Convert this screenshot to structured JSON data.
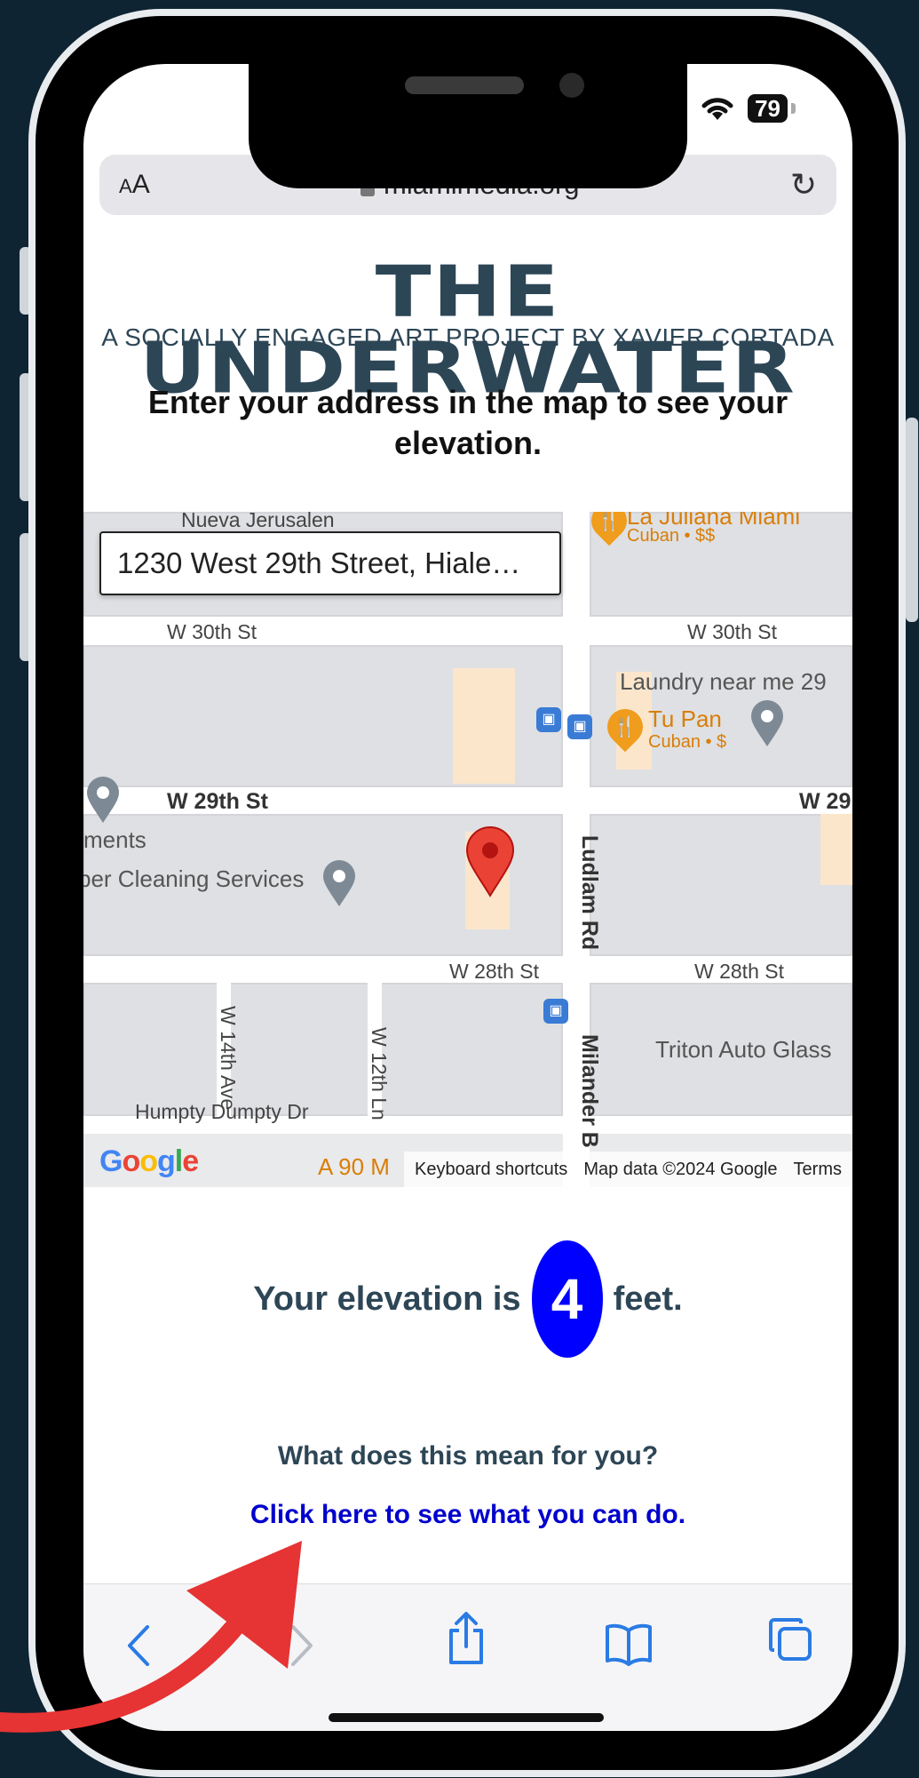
{
  "status": {
    "battery": "79"
  },
  "browser": {
    "text_size_label": "AA",
    "url": "miamimedia.org",
    "reload_icon": "reload-icon"
  },
  "page": {
    "title": "THE UNDERWATER",
    "subtitle": "A SOCIALLY ENGAGED ART PROJECT BY XAVIER CORTADA",
    "prompt": "Enter your address in the map to see your elevation."
  },
  "map": {
    "address_value": "1230 West 29th Street, Hiale…",
    "streets": {
      "w30_left": "W 30th St",
      "w30_right": "W 30th St",
      "w29": "W 29th St",
      "w29_right": "W 29",
      "w28_left": "W 28th St",
      "w28_right": "W 28th St",
      "ludlam": "Ludlam Rd",
      "milander": "Milander B",
      "w14": "W 14th Ave",
      "w12": "W 12th Ln",
      "humpty": "Humpty Dumpty Dr"
    },
    "places": {
      "nueva": "Nueva Jerusalen",
      "la_juliana": "La Juliana Miami",
      "la_juliana_sub": "Cuban • $$",
      "laundry": "Laundry near me  29",
      "tu_pan": "Tu Pan",
      "tu_pan_sub": "Cuban • $",
      "ments": "ments",
      "cleaning": "per Cleaning Services",
      "triton": "Triton Auto Glass",
      "a90": "A 90 M"
    },
    "google": "Google",
    "footer": {
      "shortcuts": "Keyboard shortcuts",
      "data": "Map data ©2024 Google",
      "terms": "Terms"
    }
  },
  "result": {
    "prefix": "Your elevation is",
    "value": "4",
    "suffix": "feet."
  },
  "meaning_text": "What does this mean for you?",
  "cta_text": "Click here to see what you can do.",
  "colors": {
    "background": "#0e2433",
    "heading": "#2d4656",
    "badge": "#0000ff",
    "link": "#0000cc",
    "arrow": "#e63333",
    "toolbar_icons": "#2a7be4"
  },
  "toolbar": {
    "icons": [
      "back-icon",
      "forward-icon",
      "share-icon",
      "bookmarks-icon",
      "tabs-icon"
    ]
  }
}
